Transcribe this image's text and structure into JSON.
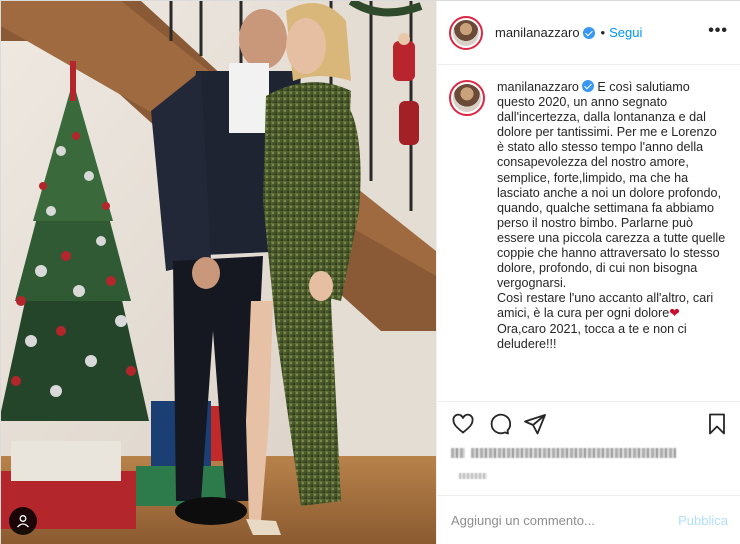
{
  "post": {
    "username": "manilanazzaro",
    "follow_label": "Segui",
    "separator": "•",
    "more_label": "•••"
  },
  "caption": {
    "username": "manilanazzaro",
    "paragraphs": [
      "E così salutiamo questo 2020, un anno segnato dall'incertezza, dalla lontananza e dal dolore per tantissimi. Per me e Lorenzo è stato allo stesso tempo l'anno della consapevolezza del nostro amore, semplice, forte,limpido, ma che ha lasciato anche a noi un dolore profondo, quando, qualche settimana fa abbiamo perso il nostro bimbo. Parlarne può essere una piccola carezza a tutte quelle coppie che hanno attraversato lo stesso dolore, profondo, di cui non bisogna vergognarsi.",
      "Così restare l'uno accanto all'altro, cari amici, è la cura per ogni dolore",
      "Ora,caro 2021, tocca a te e non ci deludere!!!"
    ],
    "heart": "❤"
  },
  "actions": {
    "like_icon": "heart-outline-icon",
    "comment_icon": "comment-bubble-icon",
    "share_icon": "paper-plane-icon",
    "save_icon": "bookmark-icon"
  },
  "comment": {
    "placeholder": "Aggiungi un commento...",
    "publish_label": "Pubblica"
  },
  "colors": {
    "link_blue": "#0095f6",
    "publish_disabled": "#b2dffc",
    "verified_blue": "#3897f0",
    "dress_green": "#4b5a2c",
    "suit_navy": "#1f2433"
  }
}
